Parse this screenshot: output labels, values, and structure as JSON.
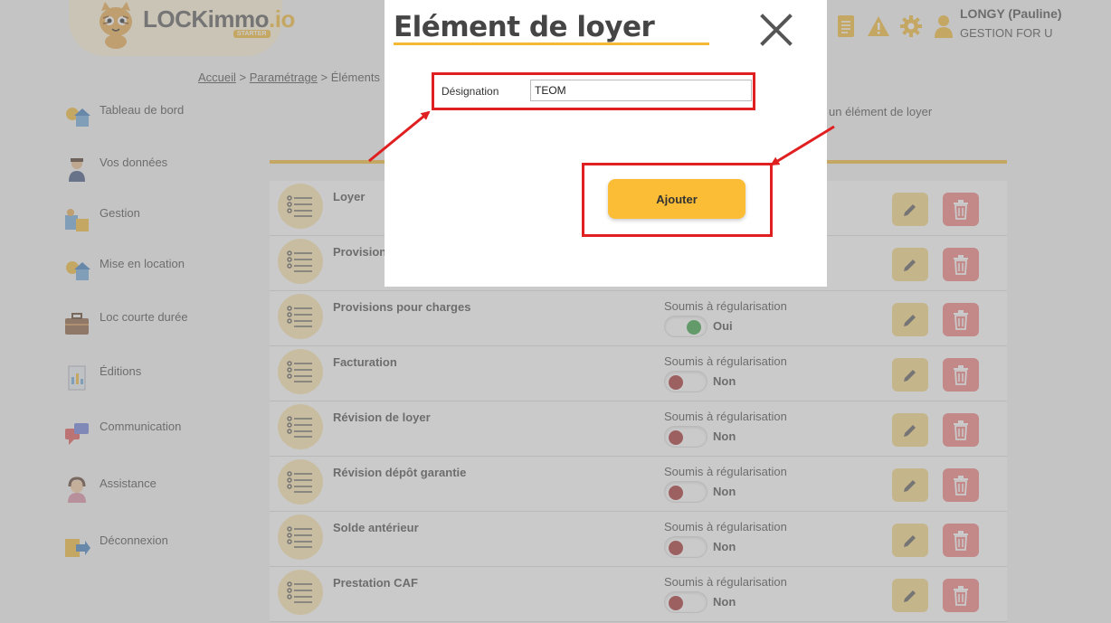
{
  "header": {
    "logo_main": "LOCKimmo",
    "logo_suffix": ".io",
    "logo_badge": "STARTER",
    "user_name": "LONGY (Pauline)",
    "company": "GESTION FOR U",
    "icons": [
      "document-icon",
      "warning-icon",
      "gear-icon",
      "user-icon"
    ]
  },
  "breadcrumb": {
    "home": "Accueil",
    "sep1": ">",
    "settings": "Paramétrage",
    "sep2": ">",
    "current": "Éléments"
  },
  "sidebar": {
    "items": [
      {
        "label": "Tableau de bord",
        "icon": "dashboard-icon"
      },
      {
        "label": "Vos données",
        "icon": "profile-icon"
      },
      {
        "label": "Gestion",
        "icon": "management-icon"
      },
      {
        "label": "Mise en location",
        "icon": "rental-icon"
      },
      {
        "label": "Loc courte durée",
        "icon": "suitcase-icon"
      },
      {
        "label": "Éditions",
        "icon": "report-icon"
      },
      {
        "label": "Communication",
        "icon": "chat-icon"
      },
      {
        "label": "Assistance",
        "icon": "support-icon"
      },
      {
        "label": "Déconnexion",
        "icon": "logout-icon"
      }
    ]
  },
  "hint_text": "un élément de loyer",
  "rows": [
    {
      "title": "Loyer",
      "reg_label": "",
      "status": ""
    },
    {
      "title": "Provision",
      "reg_label": "",
      "status": ""
    },
    {
      "title": "Provisions pour charges",
      "reg_label": "Soumis à régularisation",
      "status": "Oui"
    },
    {
      "title": "Facturation",
      "reg_label": "Soumis à régularisation",
      "status": "Non"
    },
    {
      "title": "Révision de loyer",
      "reg_label": "Soumis à régularisation",
      "status": "Non"
    },
    {
      "title": "Révision dépôt garantie",
      "reg_label": "Soumis à régularisation",
      "status": "Non"
    },
    {
      "title": "Solde antérieur",
      "reg_label": "Soumis à régularisation",
      "status": "Non"
    },
    {
      "title": "Prestation CAF",
      "reg_label": "Soumis à régularisation",
      "status": "Non"
    }
  ],
  "modal": {
    "title": "Elément de loyer",
    "field_label": "Désignation",
    "field_value": "TEOM",
    "submit_label": "Ajouter"
  },
  "colors": {
    "accent": "#f5b933",
    "highlight": "#e02020",
    "toggle_on": "#2e9e3c",
    "toggle_off": "#a52a2a"
  }
}
